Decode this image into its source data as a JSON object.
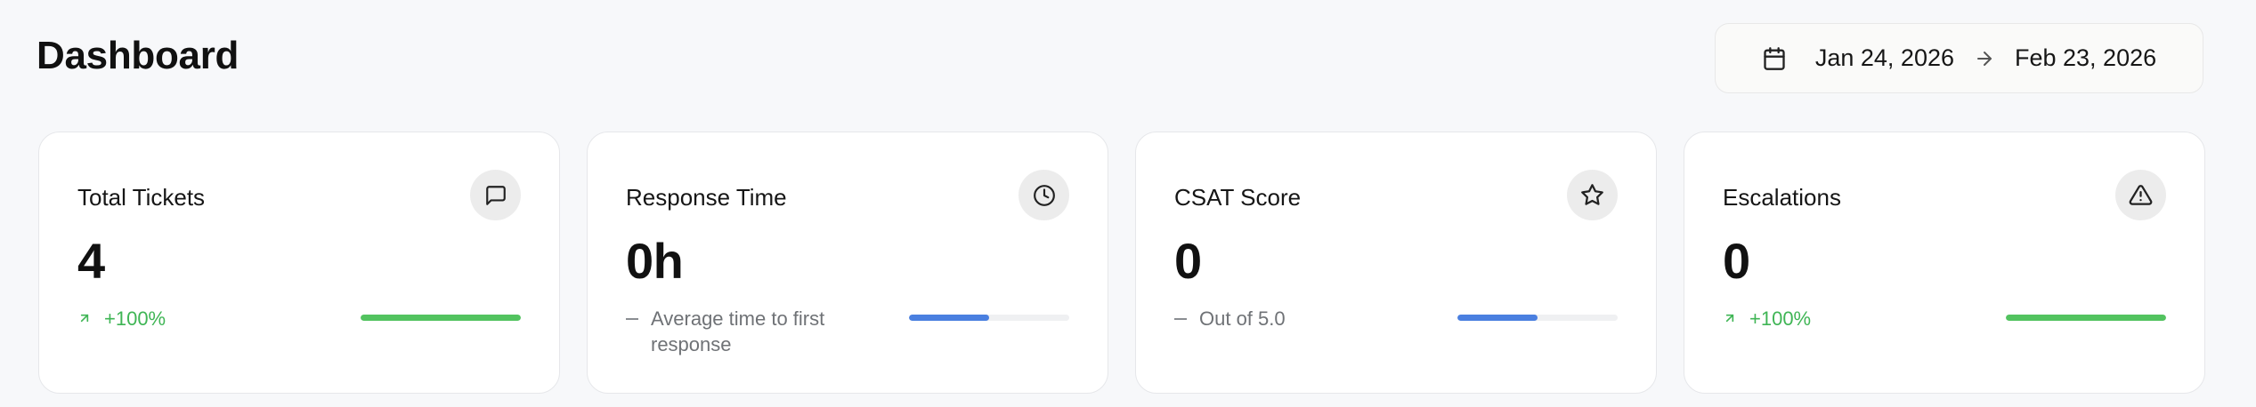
{
  "header": {
    "title": "Dashboard",
    "date_range": {
      "start": "Jan 24, 2026",
      "end": "Feb 23, 2026"
    }
  },
  "colors": {
    "success": "#4caf50",
    "info": "#4a7fe0",
    "muted": "#8a8d91"
  },
  "cards": [
    {
      "label": "Total Tickets",
      "value": "4",
      "subtext": "+100%",
      "trend": "up",
      "icon": "message-square-icon",
      "progress": 1.0,
      "bar_color": "#52c35f"
    },
    {
      "label": "Response Time",
      "value": "0h",
      "subtext": "Average time to first response",
      "trend": "neutral",
      "icon": "clock-icon",
      "progress": 0.5,
      "bar_color": "#4a7fe0"
    },
    {
      "label": "CSAT Score",
      "value": "0",
      "subtext": "Out of 5.0",
      "trend": "neutral",
      "icon": "star-icon",
      "progress": 0.5,
      "bar_color": "#4a7fe0"
    },
    {
      "label": "Escalations",
      "value": "0",
      "subtext": "+100%",
      "trend": "up",
      "icon": "alert-triangle-icon",
      "progress": 1.0,
      "bar_color": "#52c35f"
    }
  ]
}
